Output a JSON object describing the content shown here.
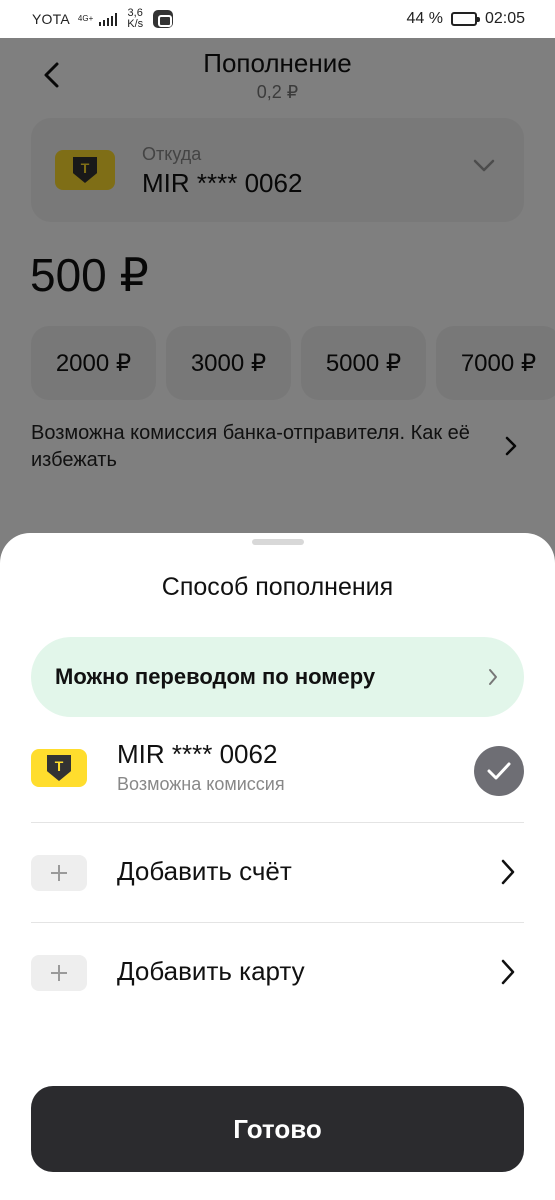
{
  "status_bar": {
    "carrier": "YOTA",
    "network": "4G+",
    "speed_value": "3,6",
    "speed_unit": "K/s",
    "battery": "44 %",
    "time": "02:05"
  },
  "background_page": {
    "title": "Пополнение",
    "subtitle": "0,2 ₽",
    "source": {
      "label": "Откуда",
      "value": "MIR **** 0062",
      "icon": "tbank-card-icon"
    },
    "amount": "500 ₽",
    "quick_amounts": [
      "2000 ₽",
      "3000 ₽",
      "5000 ₽",
      "7000 ₽"
    ],
    "fee_note": "Возможна комиссия банка-отправителя. Как её избежать"
  },
  "sheet": {
    "title": "Способ пополнения",
    "phone_transfer_banner": "Можно переводом по номеру",
    "card": {
      "title": "MIR **** 0062",
      "subtitle": "Возможна комиссия",
      "selected": true
    },
    "add_account": "Добавить счёт",
    "add_card": "Добавить карту",
    "done_button": "Готово"
  },
  "colors": {
    "accent_yellow": "#ffdd2d",
    "banner_green": "#e2f6ea",
    "button_dark": "#2b2b2e",
    "check_gray": "#6e6e74"
  }
}
